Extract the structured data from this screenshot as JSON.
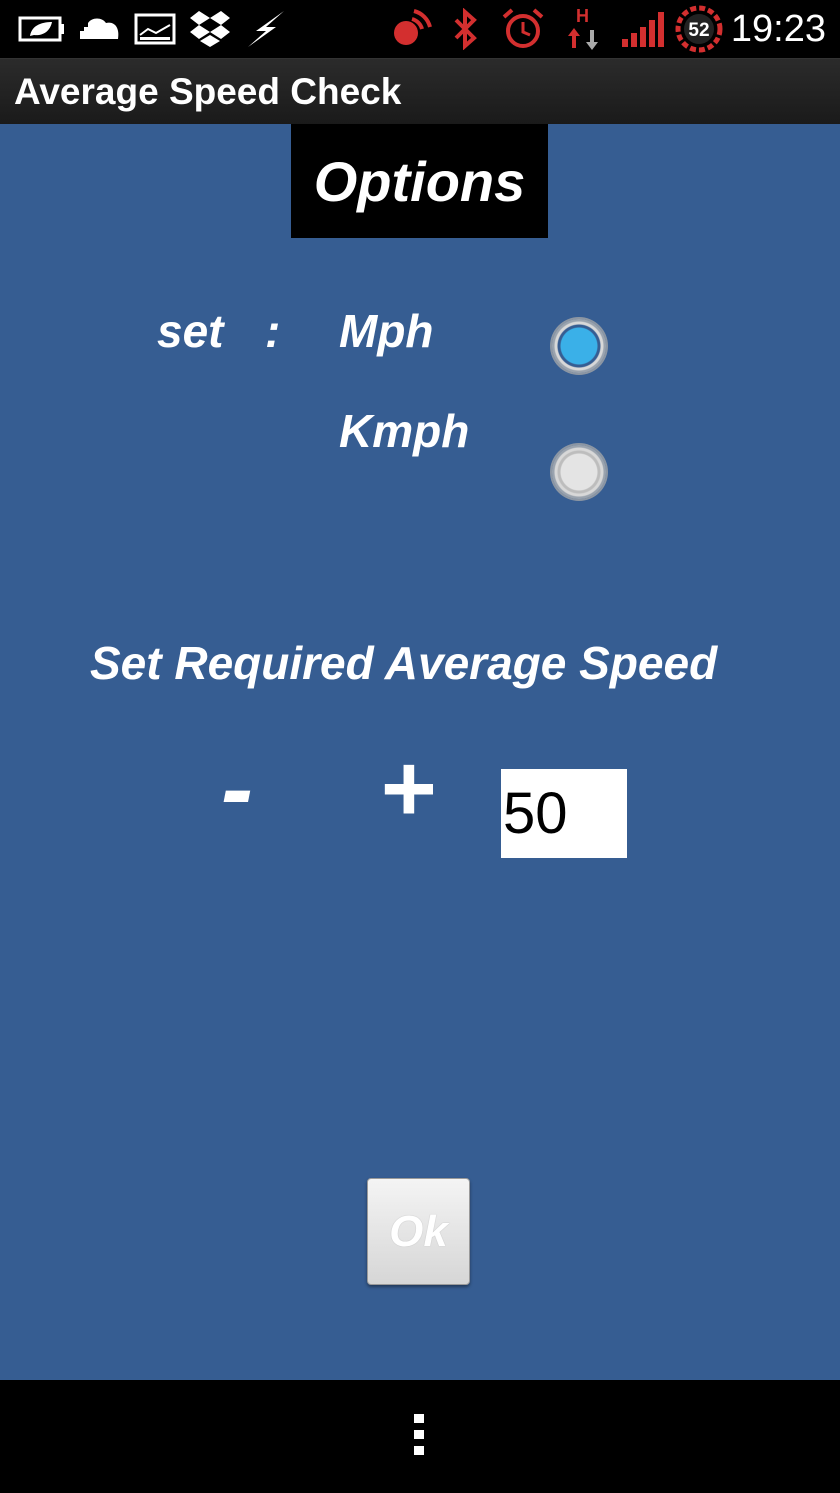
{
  "status_bar": {
    "time": "19:23",
    "battery_level": "52",
    "icons_left": [
      "battery-leaf-icon",
      "cloud-icon",
      "picture-icon",
      "dropbox-icon",
      "flash-icon"
    ],
    "icons_right": [
      "nfc-icon",
      "bluetooth-icon",
      "alarm-icon",
      "hsdpa-icon",
      "signal-icon",
      "battery-indicator-icon"
    ],
    "hsdpa_label": "H"
  },
  "app": {
    "title": "Average Speed Check"
  },
  "options": {
    "heading": "Options",
    "set_label": "set",
    "colon": ":",
    "units": [
      {
        "label": "Mph",
        "selected": true
      },
      {
        "label": "Kmph",
        "selected": false
      }
    ],
    "speed_heading": "Set Required Average Speed",
    "minus_label": "-",
    "plus_label": "+",
    "speed_value": "50",
    "ok_label": "Ok"
  },
  "colors": {
    "background": "#365d92",
    "radio_selected": "#3ab0e8",
    "status_red": "#d32f2f"
  }
}
